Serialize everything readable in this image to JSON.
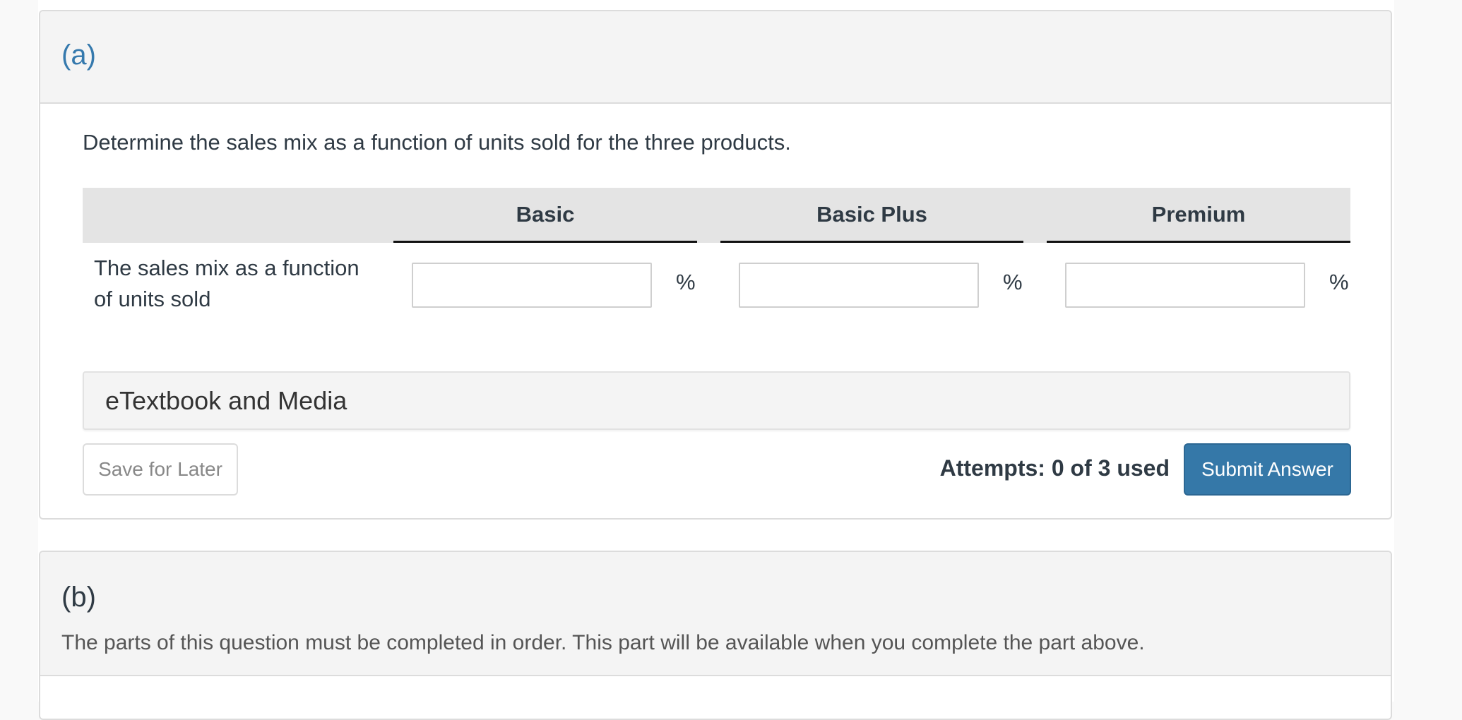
{
  "part_a": {
    "label": "(a)",
    "question": "Determine the sales mix as a function of units sold for the three products.",
    "table": {
      "columns": [
        "Basic",
        "Basic Plus",
        "Premium"
      ],
      "row_label": "The sales mix as a function of units sold",
      "row_label_line1": "The sales mix as a function",
      "row_label_line2": "of units sold",
      "inputs": [
        {
          "product": "Basic",
          "value": "",
          "unit": "%"
        },
        {
          "product": "Basic Plus",
          "value": "",
          "unit": "%"
        },
        {
          "product": "Premium",
          "value": "",
          "unit": "%"
        }
      ]
    },
    "etextbook_label": "eTextbook and Media",
    "save_label": "Save for Later",
    "attempts_text": "Attempts: 0 of 3 used",
    "submit_label": "Submit Answer"
  },
  "part_b": {
    "label": "(b)",
    "locked_message": "The parts of this question must be completed in order. This part will be available when you complete the part above."
  },
  "colors": {
    "accent": "#3578a8",
    "part_label_active": "#3579ad",
    "header_bg": "#f4f4f4",
    "table_header_bg": "#e4e4e4"
  }
}
